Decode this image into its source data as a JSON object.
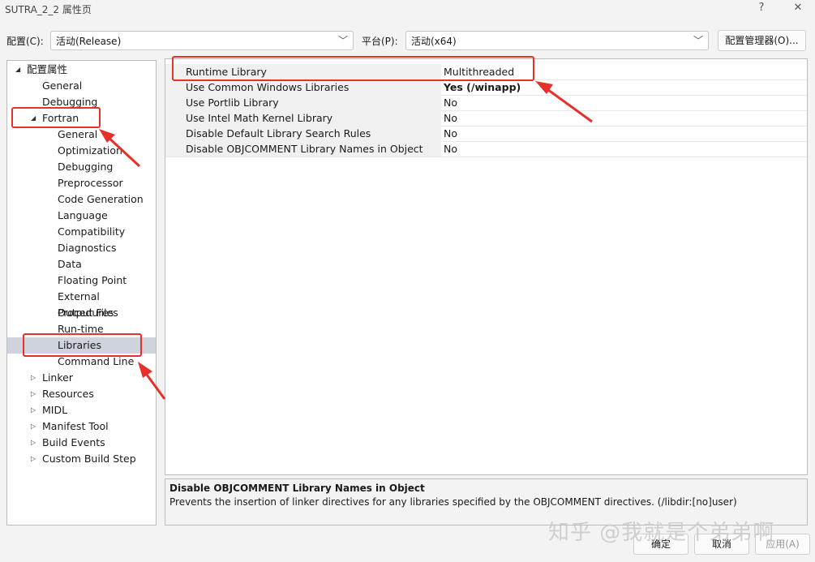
{
  "window": {
    "title": "SUTRA_2_2 属性页",
    "help_glyph": "?",
    "close_glyph": "✕"
  },
  "toolbar": {
    "config_label": "配置(C):",
    "config_value": "活动(Release)",
    "platform_label": "平台(P):",
    "platform_value": "活动(x64)",
    "config_manager_label": "配置管理器(O)..."
  },
  "tree": [
    {
      "label": "配置属性",
      "level": 0,
      "expander": "expanded"
    },
    {
      "label": "General",
      "level": 1,
      "expander": "none"
    },
    {
      "label": "Debugging",
      "level": 1,
      "expander": "none"
    },
    {
      "label": "Fortran",
      "level": 1,
      "expander": "expanded"
    },
    {
      "label": "General",
      "level": 2,
      "expander": "none"
    },
    {
      "label": "Optimization",
      "level": 2,
      "expander": "none"
    },
    {
      "label": "Debugging",
      "level": 2,
      "expander": "none"
    },
    {
      "label": "Preprocessor",
      "level": 2,
      "expander": "none"
    },
    {
      "label": "Code Generation",
      "level": 2,
      "expander": "none"
    },
    {
      "label": "Language",
      "level": 2,
      "expander": "none"
    },
    {
      "label": "Compatibility",
      "level": 2,
      "expander": "none"
    },
    {
      "label": "Diagnostics",
      "level": 2,
      "expander": "none"
    },
    {
      "label": "Data",
      "level": 2,
      "expander": "none"
    },
    {
      "label": "Floating Point",
      "level": 2,
      "expander": "none"
    },
    {
      "label": "External Procedures",
      "level": 2,
      "expander": "none"
    },
    {
      "label": "Output Files",
      "level": 2,
      "expander": "none"
    },
    {
      "label": "Run-time",
      "level": 2,
      "expander": "none"
    },
    {
      "label": "Libraries",
      "level": 2,
      "expander": "none",
      "selected": true
    },
    {
      "label": "Command Line",
      "level": 2,
      "expander": "none"
    },
    {
      "label": "Linker",
      "level": 1,
      "expander": "collapsed"
    },
    {
      "label": "Resources",
      "level": 1,
      "expander": "collapsed"
    },
    {
      "label": "MIDL",
      "level": 1,
      "expander": "collapsed"
    },
    {
      "label": "Manifest Tool",
      "level": 1,
      "expander": "collapsed"
    },
    {
      "label": "Build Events",
      "level": 1,
      "expander": "collapsed"
    },
    {
      "label": "Custom Build Step",
      "level": 1,
      "expander": "collapsed"
    }
  ],
  "properties": [
    {
      "name": "Runtime Library",
      "value": "Multithreaded",
      "bold": false
    },
    {
      "name": "Use Common Windows Libraries",
      "value": "Yes (/winapp)",
      "bold": true
    },
    {
      "name": "Use Portlib Library",
      "value": "No",
      "bold": false
    },
    {
      "name": "Use Intel Math Kernel Library",
      "value": "No",
      "bold": false
    },
    {
      "name": "Disable Default Library Search Rules",
      "value": "No",
      "bold": false
    },
    {
      "name": "Disable OBJCOMMENT Library Names in Object",
      "value": "No",
      "bold": false
    }
  ],
  "description": {
    "title": "Disable OBJCOMMENT Library Names in Object",
    "text": "Prevents the insertion of linker directives for any libraries specified by the OBJCOMMENT directives. (/libdir:[no]user)"
  },
  "footer": {
    "ok_label": "确定",
    "cancel_label": "取消",
    "apply_label": "应用(A)"
  },
  "watermark": "知乎 @我就是个弟弟啊",
  "colors": {
    "annotation_red": "#e8302a",
    "selected_row": "#cfd3dc"
  }
}
